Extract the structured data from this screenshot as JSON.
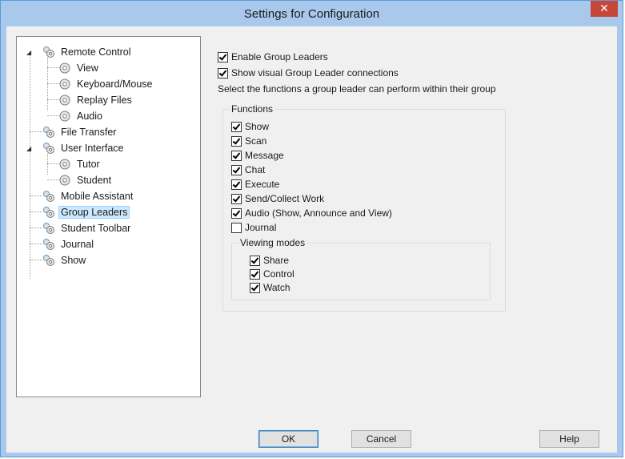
{
  "window": {
    "title": "Settings for Configuration",
    "close_glyph": "✕"
  },
  "tree": {
    "items": [
      {
        "label": "Remote Control",
        "expanded": true
      },
      {
        "label": "View"
      },
      {
        "label": "Keyboard/Mouse"
      },
      {
        "label": "Replay Files"
      },
      {
        "label": "Audio"
      },
      {
        "label": "File Transfer"
      },
      {
        "label": "User Interface",
        "expanded": true
      },
      {
        "label": "Tutor"
      },
      {
        "label": "Student"
      },
      {
        "label": "Mobile Assistant"
      },
      {
        "label": "Group Leaders",
        "selected": true
      },
      {
        "label": "Student Toolbar"
      },
      {
        "label": "Journal"
      },
      {
        "label": "Show"
      }
    ]
  },
  "options": {
    "enable_group_leaders": {
      "label": "Enable Group Leaders",
      "checked": true
    },
    "show_connections": {
      "label": "Show visual Group Leader connections",
      "checked": true
    },
    "description": "Select the functions a group leader can perform within their group"
  },
  "functions": {
    "title": "Functions",
    "items": [
      {
        "label": "Show",
        "checked": true
      },
      {
        "label": "Scan",
        "checked": true
      },
      {
        "label": "Message",
        "checked": true
      },
      {
        "label": "Chat",
        "checked": true
      },
      {
        "label": "Execute",
        "checked": true
      },
      {
        "label": "Send/Collect Work",
        "checked": true
      },
      {
        "label": "Audio (Show, Announce and View)",
        "checked": true
      },
      {
        "label": "Journal",
        "checked": false
      }
    ]
  },
  "viewing_modes": {
    "title": "Viewing modes",
    "items": [
      {
        "label": "Share",
        "checked": true
      },
      {
        "label": "Control",
        "checked": true
      },
      {
        "label": "Watch",
        "checked": true
      }
    ]
  },
  "buttons": {
    "ok": "OK",
    "cancel": "Cancel",
    "help": "Help"
  },
  "colors": {
    "titlebar": "#a9c9ec",
    "close": "#c7463a",
    "selection": "#cce8ff"
  }
}
